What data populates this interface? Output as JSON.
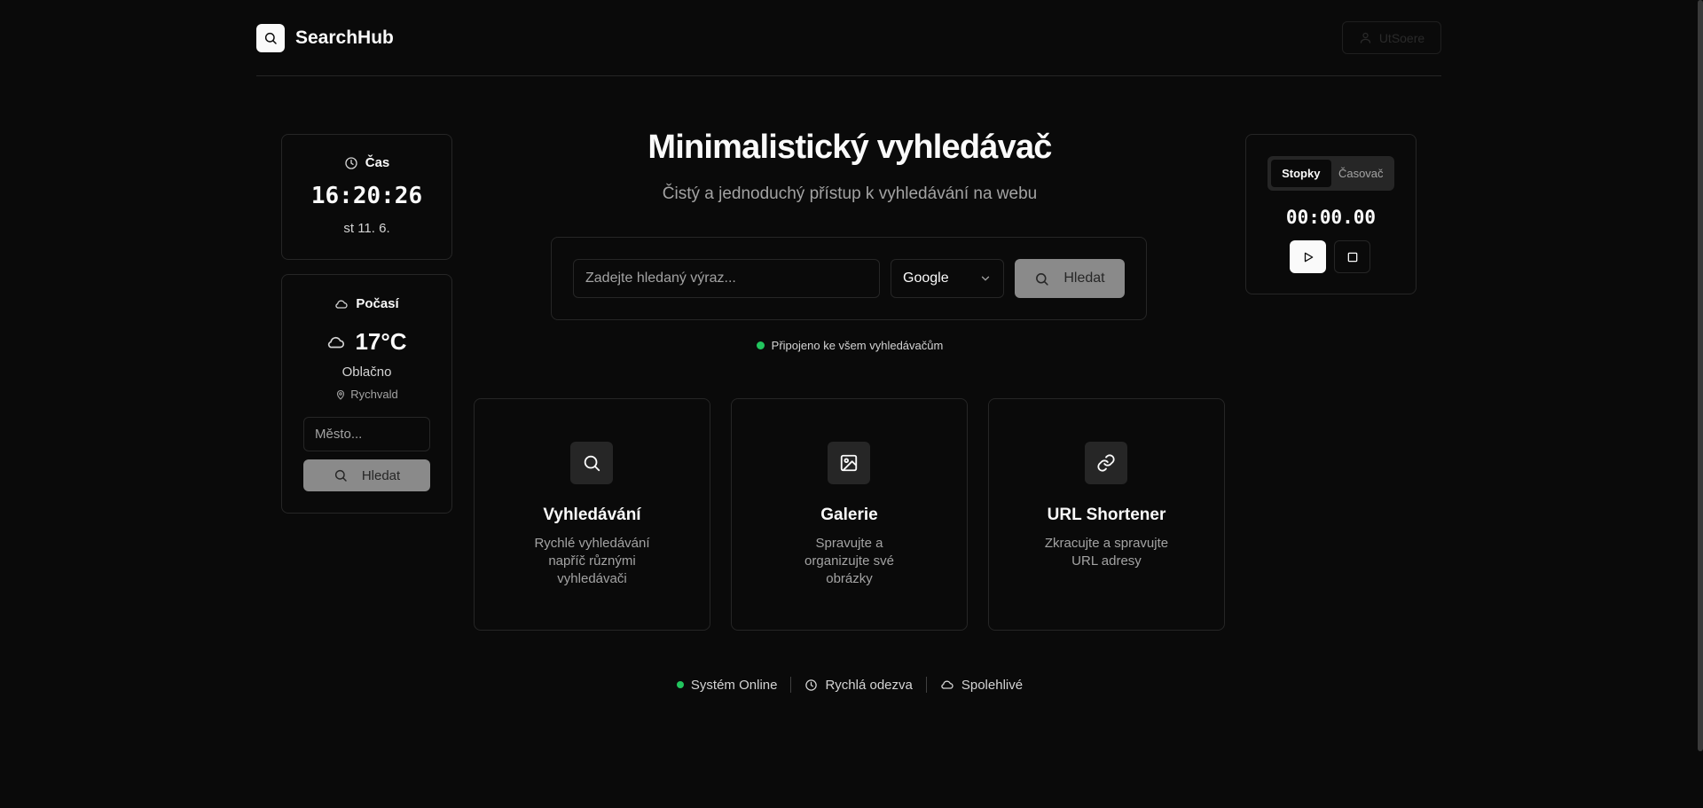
{
  "header": {
    "brand": "SearchHub",
    "login_label": "UtSoere",
    "icons": {
      "logo": "search-icon",
      "login": "user-icon"
    }
  },
  "time_widget": {
    "title": "Čas",
    "time": "16:20:26",
    "date": "st 11. 6.",
    "icon": "clock-icon"
  },
  "weather_widget": {
    "title": "Počasí",
    "temperature": "17°C",
    "condition": "Oblačno",
    "location": "Rychvald",
    "city_placeholder": "Město...",
    "search_label": "Hledat",
    "icons": {
      "title": "cloud-icon",
      "temperature": "cloud-icon",
      "location": "map-pin-icon"
    }
  },
  "hero": {
    "title": "Minimalistický vyhledávač",
    "subtitle": "Čistý a jednoduchý přístup k vyhledávání na webu"
  },
  "search": {
    "placeholder": "Zadejte hledaný výraz...",
    "engine": "Google",
    "button_label": "Hledat",
    "status": "Připojeno ke všem vyhledávačům",
    "status_color": "#22c55e"
  },
  "features": [
    {
      "title": "Vyhledávání",
      "description": "Rychlé vyhledávání napříč různými vyhledávači",
      "icon": "search-icon"
    },
    {
      "title": "Galerie",
      "description": "Spravujte a organizujte své obrázky",
      "icon": "image-icon"
    },
    {
      "title": "URL Shortener",
      "description": "Zkracujte a spravujte URL adresy",
      "icon": "link-icon"
    }
  ],
  "timer_widget": {
    "tabs": [
      {
        "label": "Stopky",
        "active": true
      },
      {
        "label": "Časovač",
        "active": false
      }
    ],
    "value": "00:00.00",
    "icons": {
      "play": "play-icon",
      "stop": "stop-icon"
    }
  },
  "footer": {
    "items": [
      {
        "label": "Systém Online",
        "icon": "status-dot"
      },
      {
        "label": "Rychlá odezva",
        "icon": "clock-icon"
      },
      {
        "label": "Spolehlivé",
        "icon": "cloud-icon"
      }
    ]
  },
  "colors": {
    "background": "#0a0a0a",
    "card_border": "#262626",
    "text": "#fafafa",
    "muted": "#a3a3a3",
    "button_disabled": "#8a8a8a",
    "online": "#22c55e"
  }
}
